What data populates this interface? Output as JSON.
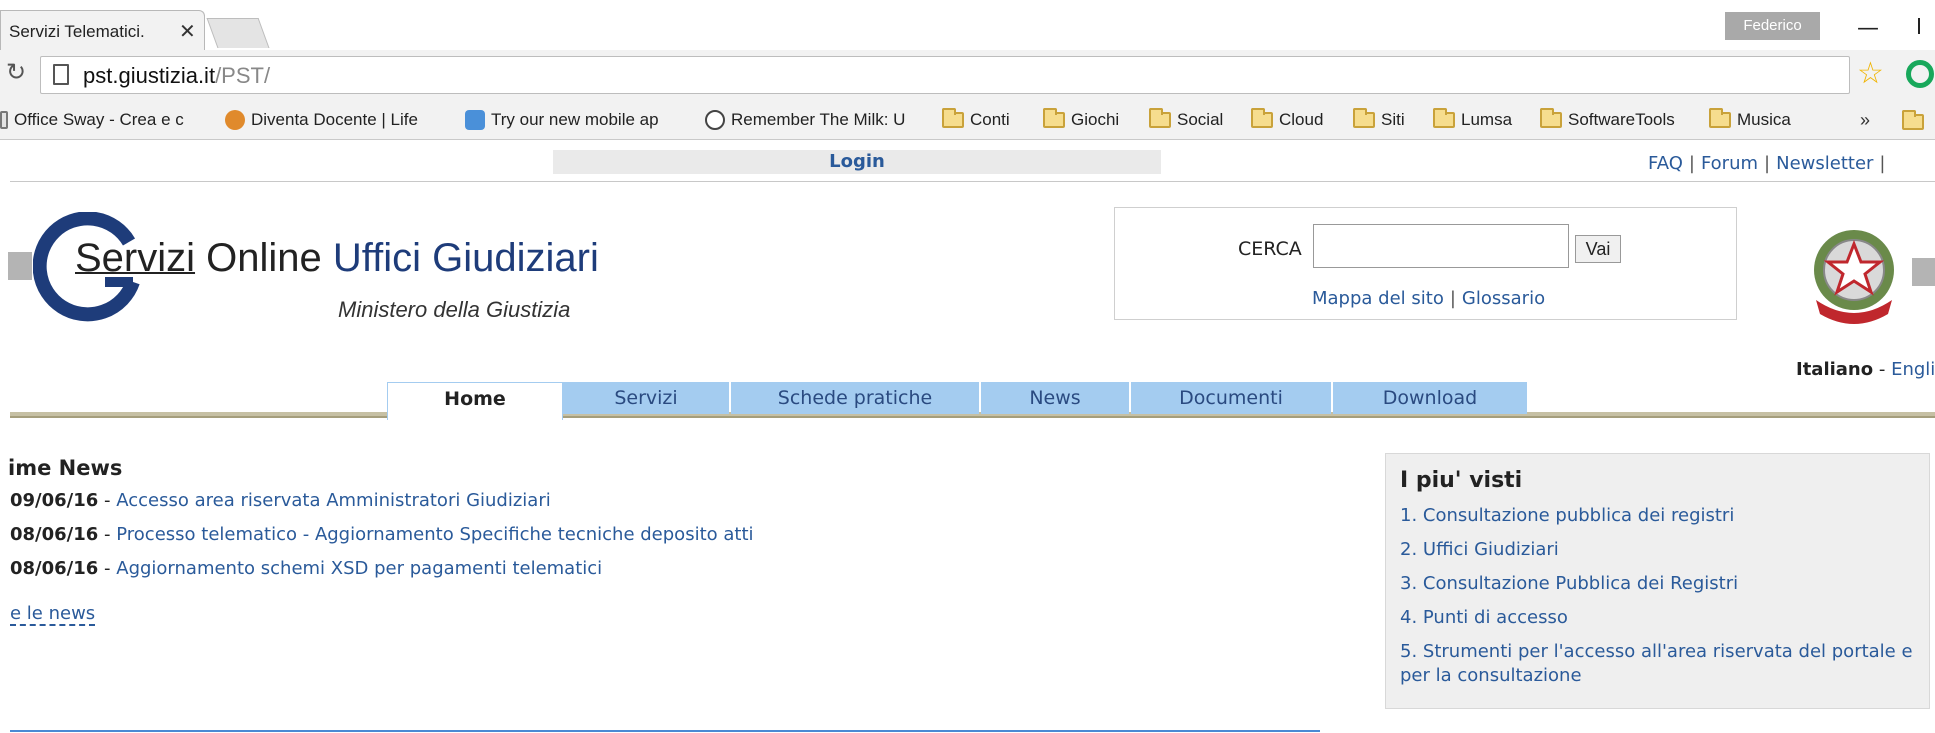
{
  "browser": {
    "tab_title": "Servizi Telematici.",
    "tab_close": "✕",
    "profile_name": "Federico",
    "url_host": "pst.giustizia.it",
    "url_path": "/PST/",
    "bookmarks": [
      {
        "label": "Office Sway - Crea e c",
        "icon": "office-sway-icon"
      },
      {
        "label": "Diventa Docente | Life",
        "icon": "owl-icon"
      },
      {
        "label": "Try our new mobile ap",
        "icon": "app-icon"
      },
      {
        "label": "Remember The Milk: U",
        "icon": "cow-icon"
      },
      {
        "label": "Conti",
        "icon": "folder-icon"
      },
      {
        "label": "Giochi",
        "icon": "folder-icon"
      },
      {
        "label": "Social",
        "icon": "folder-icon"
      },
      {
        "label": "Cloud",
        "icon": "folder-icon"
      },
      {
        "label": "Siti",
        "icon": "folder-icon"
      },
      {
        "label": "Lumsa",
        "icon": "folder-icon"
      },
      {
        "label": "SoftwareTools",
        "icon": "folder-icon"
      },
      {
        "label": "Musica",
        "icon": "folder-icon"
      }
    ],
    "bookmarks_more": "»"
  },
  "header": {
    "login": "Login",
    "top_links": [
      "FAQ",
      "Forum",
      "Newsletter"
    ],
    "logo_word1": "Servizi",
    "logo_word2": " Online ",
    "logo_brand": "Uffici Giudiziari",
    "logo_subtitle": "Ministero della Giustizia",
    "language_it": "Italiano",
    "language_sep": " - ",
    "language_en": "Engli"
  },
  "search": {
    "label": "CERCA",
    "value": "",
    "button": "Vai",
    "links": [
      "Mappa del sito",
      "Glossario"
    ]
  },
  "nav": {
    "items": [
      "Home",
      "Servizi",
      "Schede pratiche",
      "News",
      "Documenti",
      "Download"
    ],
    "active": "Home"
  },
  "news": {
    "title": "ime News",
    "items": [
      {
        "date": "09/06/16",
        "title": "Accesso area riservata Amministratori Giudiziari"
      },
      {
        "date": "08/06/16",
        "title": "Processo telematico - Aggiornamento Specifiche tecniche deposito atti"
      },
      {
        "date": "08/06/16",
        "title": "Aggiornamento schemi XSD per pagamenti telematici"
      }
    ],
    "all_news": "e le news"
  },
  "popular": {
    "title": "I piu' visti",
    "items": [
      "1. Consultazione pubblica dei registri",
      "2. Uffici Giudiziari",
      "3. Consultazione Pubblica dei Registri",
      "4. Punti di accesso",
      "5. Strumenti per l'accesso all'area riservata del portale e per la consultazione"
    ]
  },
  "colors": {
    "link": "#2a5a9a",
    "nav_tab": "#a4ccf0",
    "brand": "#1e3c7a"
  }
}
